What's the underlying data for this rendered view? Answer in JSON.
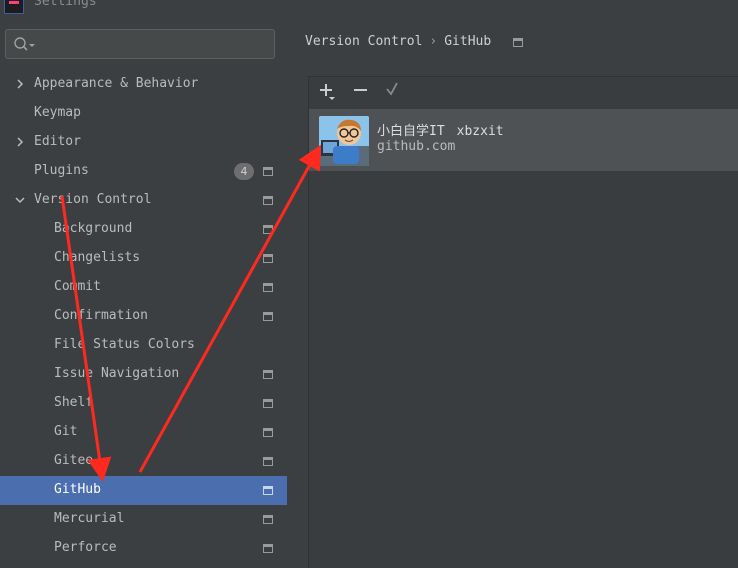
{
  "window": {
    "title": "Settings"
  },
  "search": {
    "placeholder": ""
  },
  "sidebar": {
    "items": [
      {
        "label": "Appearance & Behavior"
      },
      {
        "label": "Keymap"
      },
      {
        "label": "Editor"
      },
      {
        "label": "Plugins",
        "badge": "4"
      },
      {
        "label": "Version Control"
      },
      {
        "label": "Background"
      },
      {
        "label": "Changelists"
      },
      {
        "label": "Commit"
      },
      {
        "label": "Confirmation"
      },
      {
        "label": "File Status Colors"
      },
      {
        "label": "Issue Navigation"
      },
      {
        "label": "Shelf"
      },
      {
        "label": "Git"
      },
      {
        "label": "Gitee"
      },
      {
        "label": "GitHub"
      },
      {
        "label": "Mercurial"
      },
      {
        "label": "Perforce"
      }
    ]
  },
  "breadcrumb": {
    "parent": "Version Control",
    "separator": "›",
    "current": "GitHub"
  },
  "toolbar": {
    "add": "+",
    "remove": "−",
    "default": "✓"
  },
  "account": {
    "name": "小白自学IT",
    "login": "xbzxit",
    "server": "github.com"
  },
  "colors": {
    "selection": "#4b6eaf",
    "background": "#3c3f41",
    "annotation": "#ff2a1f"
  }
}
